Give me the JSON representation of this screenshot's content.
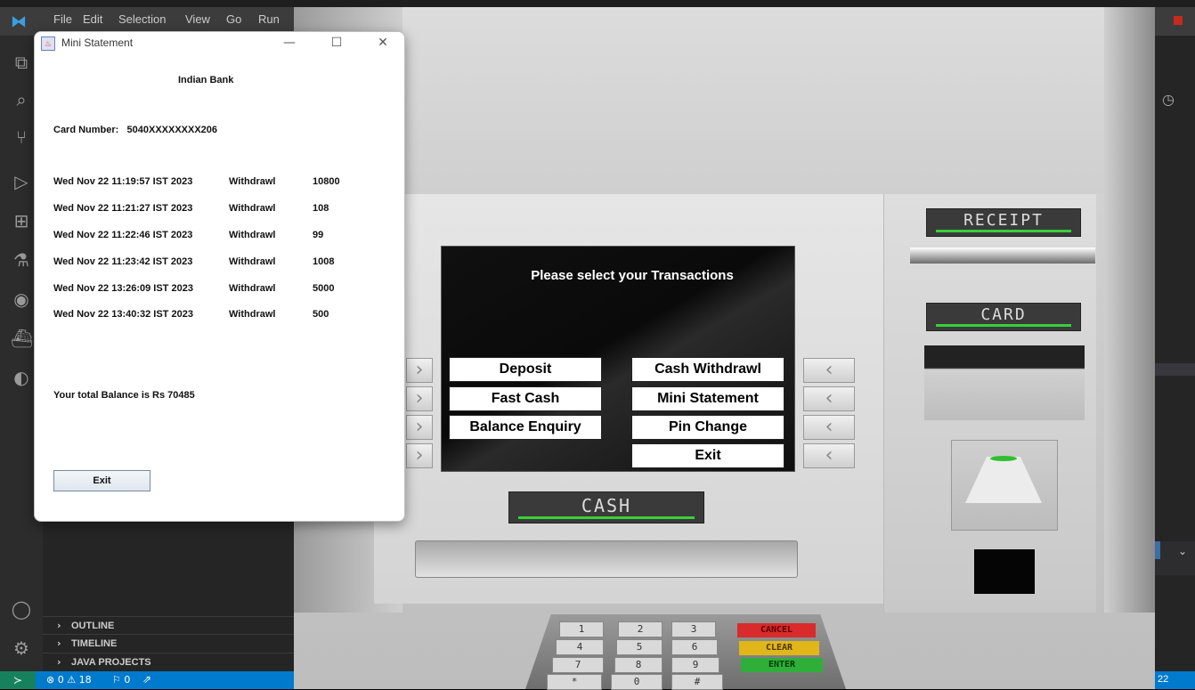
{
  "vscode": {
    "menu": [
      "File",
      "Edit",
      "Selection",
      "View",
      "Go",
      "Run"
    ],
    "sections": [
      {
        "label": "OUTLINE"
      },
      {
        "label": "TIMELINE"
      },
      {
        "label": "JAVA PROJECTS"
      }
    ],
    "status": {
      "problems": "⊗ 0 ⚠ 18",
      "ports": "⚐ 0",
      "right": "22"
    },
    "accent": "#007acc"
  },
  "window": {
    "title": "Mini Statement",
    "bank_name": "Indian Bank",
    "card_number": "Card Number:   5040XXXXXXXX206",
    "transactions": [
      {
        "date": "Wed Nov 22 11:19:57 IST 2023",
        "type": "Withdrawl",
        "amount": "10800"
      },
      {
        "date": "Wed Nov 22 11:21:27 IST 2023",
        "type": "Withdrawl",
        "amount": "108"
      },
      {
        "date": "Wed Nov 22 11:22:46 IST 2023",
        "type": "Withdrawl",
        "amount": "99"
      },
      {
        "date": "Wed Nov 22 11:23:42 IST 2023",
        "type": "Withdrawl",
        "amount": "1008"
      },
      {
        "date": "Wed Nov 22 13:26:09 IST 2023",
        "type": "Withdrawl",
        "amount": "5000"
      },
      {
        "date": "Wed Nov 22 13:40:32 IST 2023",
        "type": "Withdrawl",
        "amount": "500"
      }
    ],
    "balance": "Your total Balance is Rs 70485",
    "exit_label": "Exit",
    "controls": {
      "minimize": "—",
      "maximize": "☐",
      "close": "✕"
    }
  },
  "atm": {
    "screen_title": "Please select your Transactions",
    "buttons": {
      "deposit": "Deposit",
      "cash_withdrawl": "Cash Withdrawl",
      "fast_cash": "Fast Cash",
      "mini_statement": "Mini Statement",
      "balance_enquiry": "Balance Enquiry",
      "pin_change": "Pin Change",
      "exit": "Exit"
    },
    "labels": {
      "receipt": "RECEIPT",
      "card": "CARD",
      "cash": "CASH"
    },
    "keypad": {
      "digits": [
        "1",
        "2",
        "3",
        "4",
        "5",
        "6",
        "7",
        "8",
        "9",
        "*",
        "0",
        "#"
      ],
      "cancel": "CANCEL",
      "clear": "CLEAR",
      "enter": "ENTER"
    },
    "colors": {
      "indicator": "#37d03a",
      "cancel": "#d92b2b",
      "clear": "#e0b619",
      "enter": "#2fae3a"
    }
  }
}
